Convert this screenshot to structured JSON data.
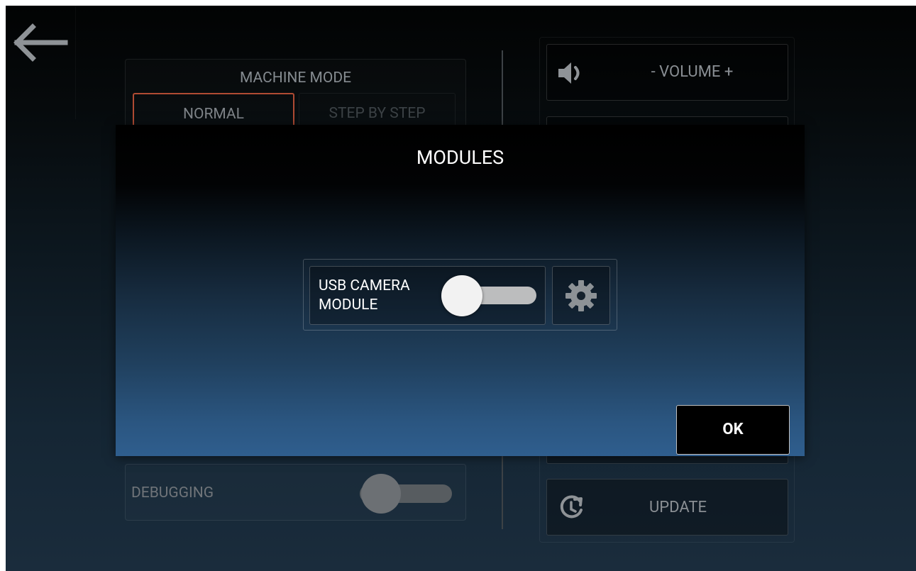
{
  "header": {
    "back_icon": "arrow-left-icon"
  },
  "machine_mode": {
    "title": "MACHINE MODE",
    "options": [
      {
        "label": "NORMAL",
        "selected": true
      },
      {
        "label": "STEP BY STEP",
        "selected": false
      }
    ],
    "selected_color": "#b04b33"
  },
  "volume": {
    "label": "- VOLUME +",
    "icon": "speaker-icon"
  },
  "debugging": {
    "label": "DEBUGGING",
    "enabled": false
  },
  "update": {
    "label": "UPDATE",
    "icon": "update-icon"
  },
  "modules_dialog": {
    "title": "MODULES",
    "modules": [
      {
        "label": "USB CAMERA\nMODULE",
        "enabled": false,
        "settings_icon": "gear-icon"
      }
    ],
    "ok_label": "OK"
  }
}
